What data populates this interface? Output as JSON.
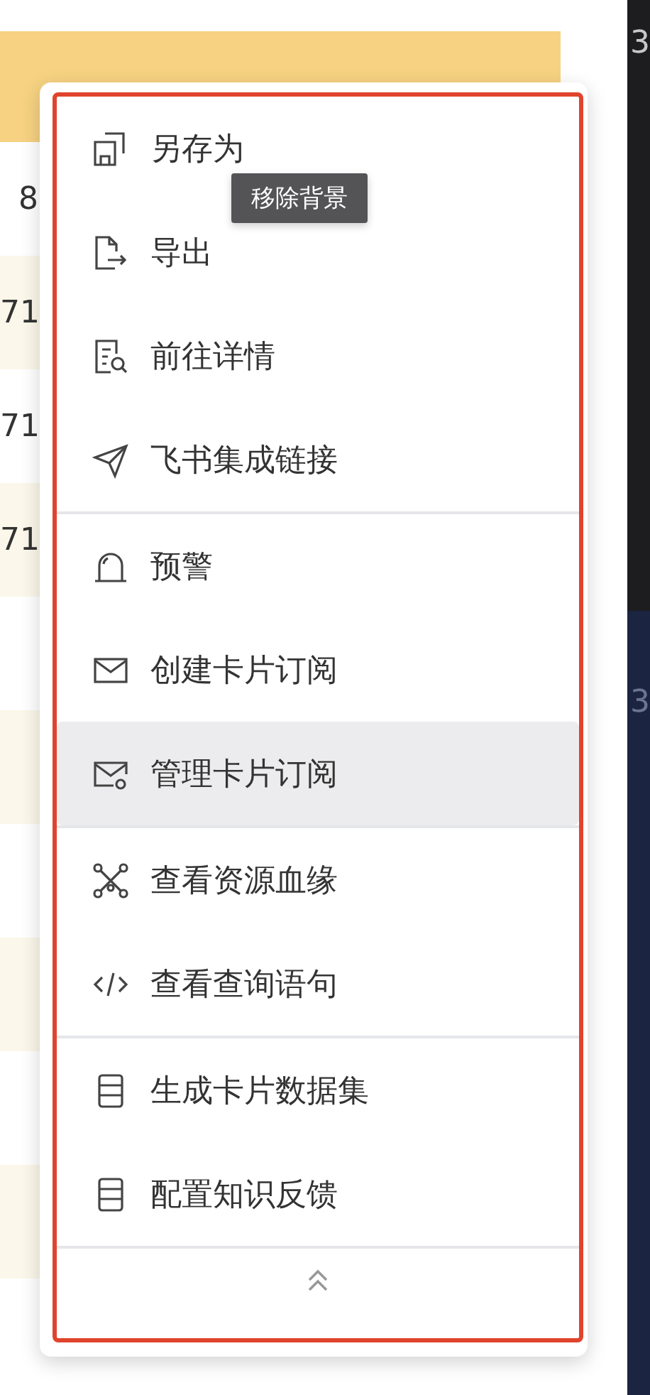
{
  "table": {
    "rows": [
      {
        "value": "8"
      },
      {
        "value": "71"
      },
      {
        "value": "71"
      },
      {
        "value": "71"
      }
    ]
  },
  "side_panel": {
    "top_value": "3",
    "bottom_value": "3"
  },
  "menu": {
    "groups": [
      [
        {
          "label": "另存为",
          "hovered": false
        },
        {
          "label": "导出",
          "hovered": false
        },
        {
          "label": "前往详情",
          "hovered": false
        },
        {
          "label": "飞书集成链接",
          "hovered": false
        }
      ],
      [
        {
          "label": "预警",
          "hovered": false
        },
        {
          "label": "创建卡片订阅",
          "hovered": false
        },
        {
          "label": "管理卡片订阅",
          "hovered": true
        }
      ],
      [
        {
          "label": "查看资源血缘",
          "hovered": false
        },
        {
          "label": "查看查询语句",
          "hovered": false
        }
      ],
      [
        {
          "label": "生成卡片数据集",
          "hovered": false
        },
        {
          "label": "配置知识反馈",
          "hovered": false
        }
      ]
    ],
    "collapse_button": true
  },
  "tooltip": {
    "text": "移除背景"
  }
}
